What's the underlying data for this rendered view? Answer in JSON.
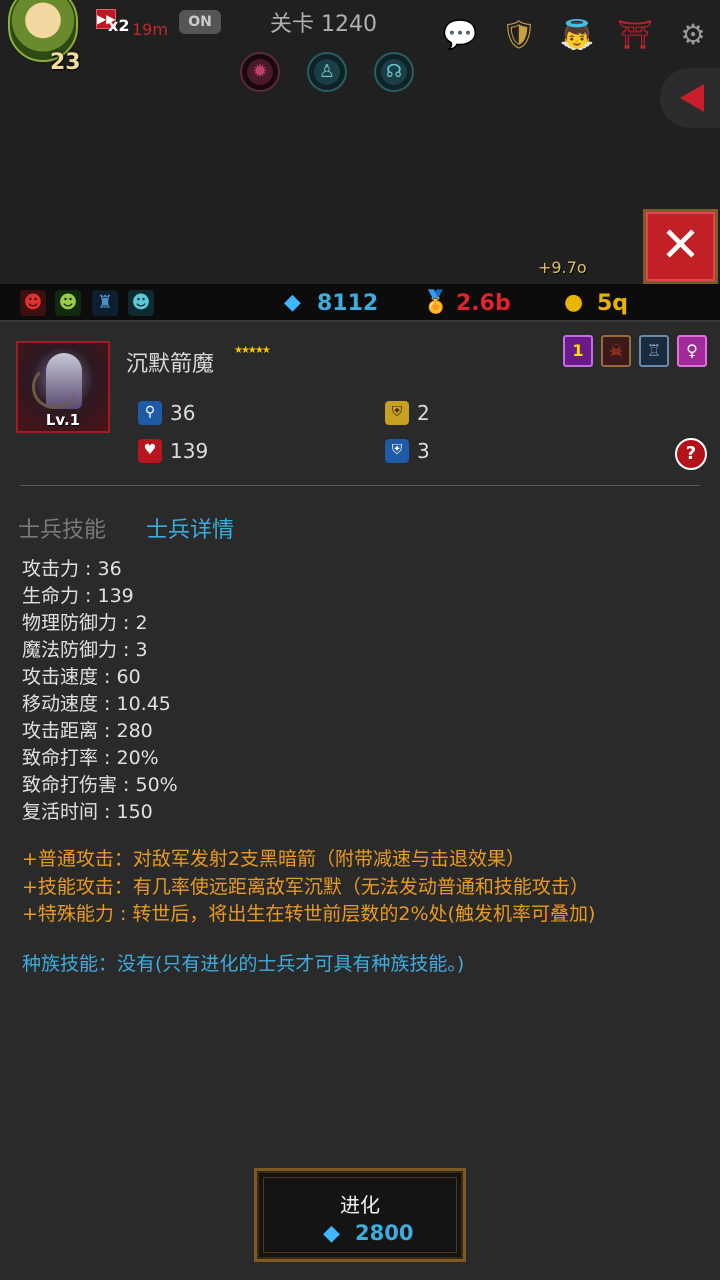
{
  "hud": {
    "player_level": "23",
    "speed_multiplier": "x2",
    "speed_time": "19m",
    "auto_toggle": "ON",
    "stage": "关卡 1240",
    "drop_indicator": "+9.7o"
  },
  "resources": {
    "diamonds": "8112",
    "medals": "2.6b",
    "gold": "5q"
  },
  "unit": {
    "name": "沉默箭魔",
    "stars": "★★★★★",
    "level": "Lv.1",
    "tag_number": "1",
    "attack": "36",
    "hp": "139",
    "phys_def": "2",
    "magic_def": "3"
  },
  "tabs": {
    "skills": "士兵技能",
    "details": "士兵详情"
  },
  "details": [
    "攻击力 : 36",
    "生命力 : 139",
    "物理防御力 : 2",
    "魔法防御力 : 3",
    "攻击速度 : 60",
    "移动速度 : 10.45",
    "攻击距离 : 280",
    "致命打率 : 20%",
    "致命打伤害 : 50%",
    "复活时间 : 150"
  ],
  "descriptions": [
    "+普通攻击：对敌军发射2支黑暗箭（附带减速与击退效果）",
    "+技能攻击：有几率使远距离敌军沉默（无法发动普通和技能攻击）",
    "+特殊能力 : 转世后，将出生在转世前层数的2%处(触发机率可叠加)"
  ],
  "race_skill": "种族技能：没有(只有进化的士兵才可具有种族技能。)",
  "evolve": {
    "label": "进化",
    "cost": "2800"
  },
  "colors": {
    "accent_blue": "#3dacde",
    "skill_orange": "#e89a22",
    "close_red": "#c12126",
    "medal_red": "#e0242a",
    "gold_yellow": "#e8b400"
  }
}
